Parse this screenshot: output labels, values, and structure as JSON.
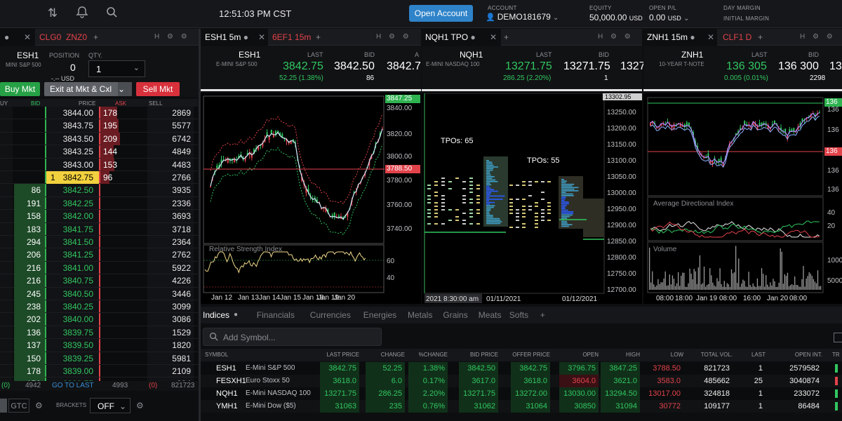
{
  "topbar": {
    "time": "12:51:03 PM CST",
    "open_account": "Open Account",
    "account_label": "ACCOUNT",
    "account_value": "DEMO181679",
    "equity_label": "EQUITY",
    "equity_value": "50,000.00",
    "equity_ccy": "USD",
    "openpl_label": "OPEN P/L",
    "openpl_value": "0.00",
    "openpl_ccy": "USD",
    "day_margin_label": "DAY MARGIN",
    "initial_margin_label": "INITIAL MARGIN"
  },
  "panel1": {
    "tab_inactive": "CLG0",
    "tab_inactive2": "ZNZ0",
    "symbol": "ESH1",
    "symbol_sub": "MINI S&P 500",
    "position_label": "POSITION",
    "position_value": "0",
    "position_ccy": "-.-- USD",
    "qty_label": "QTY.",
    "qty_value": "1",
    "buy_mkt": "Buy Mkt",
    "exit_mkt": "Exit at Mkt & Cxl",
    "sell_mkt": "Sell Mkt",
    "col_buy": "UY",
    "col_bid": "BID",
    "col_price": "PRICE",
    "col_ask": "ASK",
    "col_sell": "SELL",
    "rows": [
      {
        "bid": "",
        "price": "3844.00",
        "ask": "178",
        "sell": "2869"
      },
      {
        "bid": "",
        "price": "3843.75",
        "ask": "195",
        "sell": "5577"
      },
      {
        "bid": "",
        "price": "3843.50",
        "ask": "209",
        "sell": "6742"
      },
      {
        "bid": "",
        "price": "3843.25",
        "ask": "144",
        "sell": "4849"
      },
      {
        "bid": "",
        "price": "3843.00",
        "ask": "153",
        "sell": "4483"
      },
      {
        "bid": "",
        "price": "3842.75",
        "ask": "96",
        "sell": "2766",
        "marker": "1"
      },
      {
        "bid": "86",
        "price": "3842.50",
        "ask": "",
        "sell": "3935"
      },
      {
        "bid": "191",
        "price": "3842.25",
        "ask": "",
        "sell": "2336"
      },
      {
        "bid": "158",
        "price": "3842.00",
        "ask": "",
        "sell": "3693"
      },
      {
        "bid": "183",
        "price": "3841.75",
        "ask": "",
        "sell": "3718"
      },
      {
        "bid": "294",
        "price": "3841.50",
        "ask": "",
        "sell": "2364"
      },
      {
        "bid": "206",
        "price": "3841.25",
        "ask": "",
        "sell": "2762"
      },
      {
        "bid": "216",
        "price": "3841.00",
        "ask": "",
        "sell": "5922"
      },
      {
        "bid": "216",
        "price": "3840.75",
        "ask": "",
        "sell": "4226"
      },
      {
        "bid": "245",
        "price": "3840.50",
        "ask": "",
        "sell": "3446"
      },
      {
        "bid": "238",
        "price": "3840.25",
        "ask": "",
        "sell": "3099"
      },
      {
        "bid": "202",
        "price": "3840.00",
        "ask": "",
        "sell": "3086"
      },
      {
        "bid": "136",
        "price": "3839.75",
        "ask": "",
        "sell": "1529"
      },
      {
        "bid": "137",
        "price": "3839.50",
        "ask": "",
        "sell": "1820"
      },
      {
        "bid": "150",
        "price": "3839.25",
        "ask": "",
        "sell": "5981"
      },
      {
        "bid": "178",
        "price": "3839.00",
        "ask": "",
        "sell": "2109"
      },
      {
        "bid": "156",
        "price": "3838.75",
        "ask": "",
        "sell": "884"
      }
    ],
    "footer_left": "(0)",
    "footer_bid_total": "4942",
    "go_to_last": "GO TO LAST",
    "footer_ask_total": "4993",
    "footer_sell_paren": "(0)",
    "footer_sell_total": "821723",
    "gtc": "GTC",
    "brackets_label": "BRACKETS",
    "brackets_value": "OFF"
  },
  "panel2": {
    "tab_active": "ESH1 5m",
    "tab_inactive": "6EF1 15m",
    "symbol": "ESH1",
    "symbol_sub": "E-MINI S&P 500",
    "last_label": "LAST",
    "last": "3842.75",
    "change": "52.25 (1.38%)",
    "bid_label": "BID",
    "bid": "3842.50",
    "bid_size": "86",
    "ask_partial": "3842.7",
    "ask_label": "A",
    "price_tag_top": "3847.25",
    "price_tag_mid": "3788.50",
    "y_ticks": [
      "3840.00",
      "3820.00",
      "3800.00",
      "3780.00",
      "3760.00",
      "3740.00"
    ],
    "rsi_label": "Relative Strength Index",
    "rsi_ticks": [
      "60",
      "40"
    ],
    "x_ticks": [
      "Jan 12",
      "Jan 13",
      "Jan 14",
      "Jan 15",
      "Jan 18",
      "Jan 19",
      "Jan 20"
    ]
  },
  "panel3": {
    "tab_active": "NQH1 TPO",
    "symbol": "NQH1",
    "symbol_sub": "E-MINI NASDAQ 100",
    "last_label": "LAST",
    "last": "13271.75",
    "change": "286.25 (2.20%)",
    "bid_label": "BID",
    "bid": "13271.75",
    "bid_size": "1",
    "ask_partial": "1327",
    "price_tag_top": "13302.95",
    "tpo1": "TPOs: 65",
    "tpo2": "TPOs: 55",
    "y_ticks": [
      "13250.00",
      "13200.00",
      "13150.00",
      "13100.00",
      "13050.00",
      "13000.00",
      "12950.00",
      "12900.00",
      "12850.00",
      "12800.00",
      "12750.00",
      "12700.00"
    ],
    "x_tick_hl": "2021 8:30:00 am",
    "x_ticks": [
      "01/11/2021",
      "01/12/2021"
    ]
  },
  "panel4": {
    "tab_active": "ZNH1 15m",
    "tab_inactive": "CLF1 D",
    "symbol": "ZNH1",
    "symbol_sub": "10-YEAR T-NOTE",
    "last_label": "LAST",
    "last": "136 305",
    "change": "0.005 (0.01%)",
    "bid_label": "BID",
    "bid": "136 300",
    "bid_size": "2298",
    "ask_partial": "136",
    "price_tag_top": "136",
    "price_tag_mid": "136",
    "y_ticks": [
      "136",
      "136",
      "136",
      "136"
    ],
    "adx_label": "Average Directional Index",
    "adx_ticks": [
      "40",
      "20"
    ],
    "vol_label": "Volume",
    "vol_ticks": [
      "10000",
      "5000"
    ],
    "x_ticks": [
      "08:00",
      "18:00",
      "Jan 19",
      "08:00",
      "16:00",
      "Jan 20",
      "08:00"
    ]
  },
  "indices": {
    "tabs": [
      "Indices",
      "Financials",
      "Currencies",
      "Energies",
      "Metals",
      "Grains",
      "Meats",
      "Softs"
    ],
    "add_symbol_placeholder": "Add Symbol...",
    "columns": [
      "SYMBOL",
      "LAST PRICE",
      "CHANGE",
      "%CHANGE",
      "BID PRICE",
      "OFFER PRICE",
      "OPEN",
      "HIGH",
      "LOW",
      "TOTAL VOL.",
      "LAST",
      "OPEN INT.",
      "TR"
    ],
    "rows": [
      {
        "sym": "ESH1",
        "name": "E-Mini S&P 500",
        "last": "3842.75",
        "chg": "52.25",
        "pct": "1.38%",
        "bid": "3842.50",
        "offer": "3842.75",
        "open": "3796.75",
        "high": "3847.25",
        "low": "3788.50",
        "vol": "821723",
        "lastq": "1",
        "oi": "2579582"
      },
      {
        "sym": "FESXH1",
        "name": "Euro Stoxx 50",
        "last": "3618.0",
        "chg": "6.0",
        "pct": "0.17%",
        "bid": "3617.0",
        "offer": "3618.0",
        "open": "3604.0",
        "high": "3621.0",
        "low": "3583.0",
        "vol": "485662",
        "lastq": "25",
        "oi": "3040874"
      },
      {
        "sym": "NQH1",
        "name": "E-Mini NASDAQ 100",
        "last": "13271.75",
        "chg": "286.25",
        "pct": "2.20%",
        "bid": "13271.75",
        "offer": "13272.00",
        "open": "13030.00",
        "high": "13294.50",
        "low": "13017.00",
        "vol": "324818",
        "lastq": "1",
        "oi": "233072"
      },
      {
        "sym": "YMH1",
        "name": "E-Mini Dow ($5)",
        "last": "31063",
        "chg": "235",
        "pct": "0.76%",
        "bid": "31062",
        "offer": "31064",
        "open": "30850",
        "high": "31094",
        "low": "30772",
        "vol": "109177",
        "lastq": "1",
        "oi": "86484"
      }
    ]
  },
  "colors": {
    "up": "#31c760",
    "down": "#e2434b",
    "accent": "#2f83c9"
  }
}
